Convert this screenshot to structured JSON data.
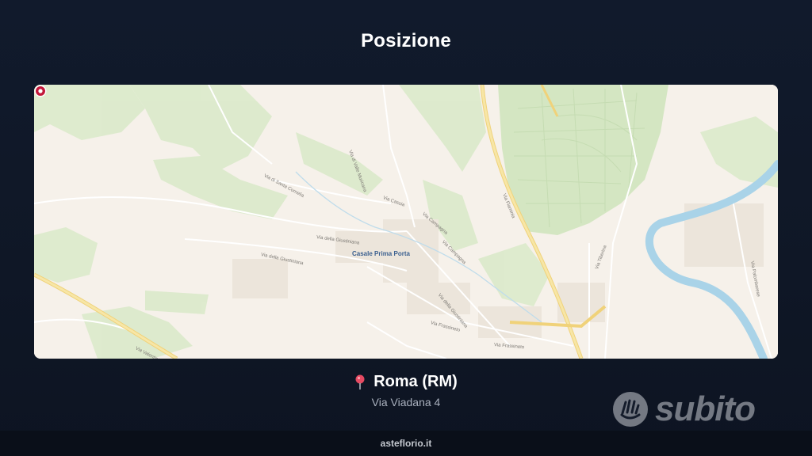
{
  "header": {
    "title": "Posizione"
  },
  "map": {
    "place_label": "Casale Prima Porta",
    "roads": [
      "Via Flaminia",
      "Via Tiberina",
      "Via della Giustiniana",
      "Via della Giustiniana",
      "Via Frassineto",
      "Via Frassineto",
      "Via Valentini",
      "Via Cassia",
      "Via Campagna",
      "Via Campagna",
      "Via di Valle Muricana",
      "Via di Santa Cornelia",
      "Via della Giustiniana",
      "Via Palombarese"
    ],
    "colors": {
      "land": "#f6f1ea",
      "park": "#d8e8c8",
      "river": "#a9d3e8",
      "main_road": "#f3dc8a",
      "pin": "#c2183a"
    }
  },
  "location": {
    "icon": "map-pin-icon",
    "city": "Roma (RM)",
    "address": "Via Viadana 4"
  },
  "watermark": {
    "text": "subito",
    "icon": "subito-hand-icon"
  },
  "footer": {
    "text": "asteflorio.it"
  }
}
